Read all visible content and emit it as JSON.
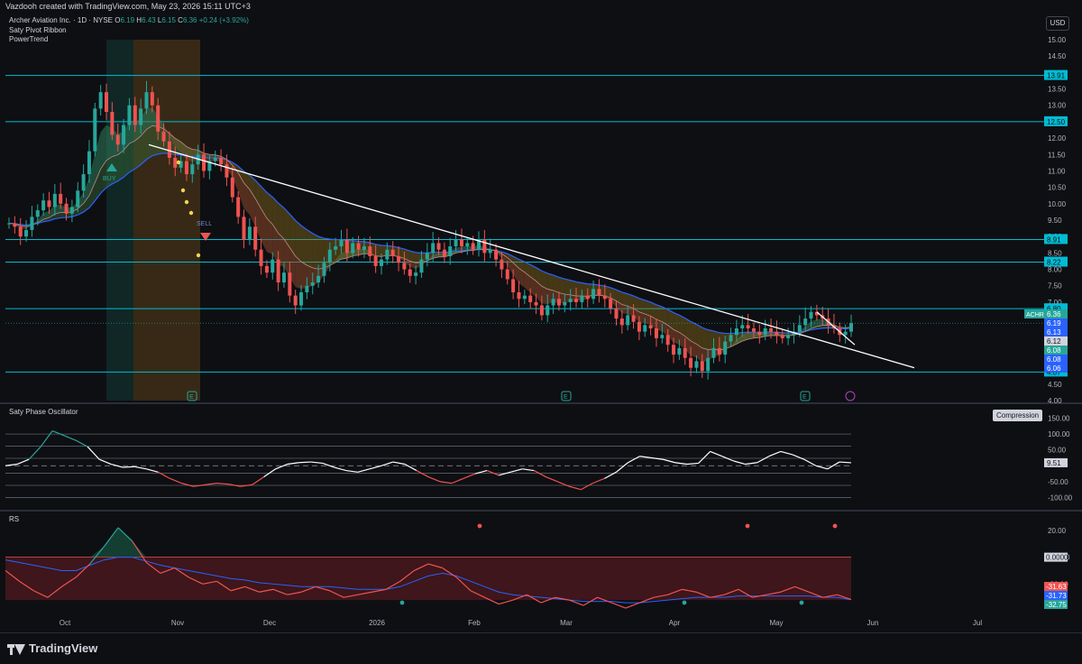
{
  "header": {
    "watermark": "Vazdooh created with TradingView.com, May 23, 2026 15:11 UTC+3"
  },
  "legend": {
    "symbol_line": "Archer Aviation Inc. · 1D · NYSE",
    "open_label": "O",
    "open": "6.19",
    "high_label": "H",
    "high": "6.43",
    "low_label": "L",
    "low": "6.15",
    "close_label": "C",
    "close": "6.36",
    "change": "+0.24 (+3.92%)",
    "indicator_1": "Saty Pivot Ribbon",
    "indicator_2": "PowerTrend"
  },
  "currency_button": "USD",
  "compression_badge": "Compression",
  "oscillator_title": "Saty Phase Oscillator",
  "rs_title": "RS",
  "footer": {
    "brand": "TradingView"
  },
  "colors": {
    "up": "#26a69a",
    "down": "#ef5350",
    "level": "#00bcd4",
    "ema_blue": "#2962ff",
    "trend": "#ffffff",
    "bg": "#0e0f13"
  },
  "chart_data": [
    {
      "type": "candlestick",
      "symbol": "ACHR",
      "ylim": [
        4.0,
        15.0
      ],
      "y_ticks": [
        "15.00",
        "14.50",
        "14.00",
        "13.50",
        "13.00",
        "12.50",
        "12.00",
        "11.50",
        "11.00",
        "10.50",
        "10.00",
        "9.50",
        "9.00",
        "8.50",
        "8.00",
        "7.50",
        "7.00",
        "6.50",
        "6.00",
        "5.50",
        "5.00",
        "4.50",
        "4.00"
      ],
      "x_labels": [
        "Oct",
        "Nov",
        "Dec",
        "2026",
        "Feb",
        "Mar",
        "Apr",
        "May",
        "Jun",
        "Jul"
      ],
      "horizontal_levels": [
        {
          "value": 13.91,
          "label": "13.91"
        },
        {
          "value": 12.5,
          "label": "12.50"
        },
        {
          "value": 8.91,
          "label": "8.91"
        },
        {
          "value": 8.22,
          "label": "8.22"
        },
        {
          "value": 6.8,
          "label": "6.80"
        },
        {
          "value": 4.87,
          "label": "4.87"
        }
      ],
      "price_labels": [
        {
          "value": 6.36,
          "label": "6.36",
          "color": "#26a69a",
          "tag": "ACHR"
        },
        {
          "value": 6.19,
          "label": "6.19",
          "color": "#2962ff"
        },
        {
          "value": 6.13,
          "label": "6.13",
          "color": "#2962ff"
        },
        {
          "value": 6.12,
          "label": "6.12",
          "color": "#d1d4dc"
        },
        {
          "value": 6.08,
          "label": "6.08",
          "color": "#26a69a"
        },
        {
          "value": 6.08,
          "label": "6.08",
          "color": "#2962ff"
        },
        {
          "value": 6.06,
          "label": "6.06",
          "color": "#2962ff"
        }
      ],
      "annotations": [
        "BUY",
        "SELL"
      ],
      "event_markers": [
        "E",
        "E",
        "E"
      ],
      "closes": [
        9.4,
        9.3,
        9.0,
        9.2,
        9.6,
        9.8,
        10.1,
        9.9,
        10.3,
        10.0,
        9.7,
        9.9,
        10.4,
        10.9,
        11.6,
        12.9,
        13.4,
        12.8,
        12.1,
        11.8,
        12.4,
        13.0,
        12.4,
        12.9,
        13.4,
        13.0,
        12.2,
        11.9,
        11.4,
        11.1,
        11.3,
        10.9,
        11.2,
        11.5,
        11.0,
        11.3,
        11.4,
        11.2,
        10.8,
        10.2,
        9.6,
        8.9,
        9.3,
        8.6,
        8.1,
        7.9,
        8.3,
        7.6,
        7.9,
        7.2,
        6.9,
        7.3,
        7.5,
        7.6,
        7.8,
        8.2,
        8.6,
        8.7,
        8.9,
        8.5,
        8.8,
        8.6,
        8.7,
        8.4,
        8.1,
        8.3,
        8.6,
        8.4,
        8.2,
        8.0,
        7.8,
        7.9,
        8.3,
        8.5,
        8.8,
        8.6,
        8.4,
        8.7,
        8.9,
        8.7,
        8.8,
        8.6,
        8.9,
        8.5,
        8.6,
        8.3,
        8.0,
        7.7,
        7.3,
        7.1,
        7.2,
        7.0,
        6.9,
        6.6,
        6.9,
        7.1,
        6.9,
        7.0,
        7.1,
        7.0,
        7.2,
        7.1,
        7.4,
        7.2,
        7.1,
        6.8,
        6.5,
        6.3,
        6.6,
        6.4,
        6.1,
        6.3,
        6.2,
        5.9,
        6.0,
        5.7,
        5.4,
        5.6,
        5.3,
        5.0,
        5.2,
        4.9,
        5.3,
        5.6,
        5.4,
        5.8,
        6.0,
        6.2,
        6.3,
        6.2,
        6.1,
        6.0,
        6.2,
        6.1,
        6.0,
        5.9,
        6.0,
        6.1,
        6.3,
        6.5,
        6.7,
        6.6,
        6.5,
        6.3,
        6.2,
        6.0,
        6.1,
        6.36
      ]
    },
    {
      "type": "line",
      "name": "Saty Phase Oscillator",
      "ylim": [
        -130,
        160
      ],
      "y_ticks": [
        "150.00",
        "100.00",
        "50.00",
        "-50.00",
        "-100.00"
      ],
      "value_label": "9.51",
      "levels": [
        100,
        61.8,
        23.6,
        0,
        -23.6,
        -61.8,
        -100
      ],
      "values": [
        0,
        5,
        20,
        60,
        110,
        95,
        80,
        60,
        20,
        5,
        -5,
        -3,
        -10,
        -20,
        -40,
        -55,
        -65,
        -60,
        -55,
        -58,
        -65,
        -60,
        -35,
        -10,
        5,
        10,
        12,
        8,
        -5,
        -15,
        -20,
        -10,
        0,
        12,
        5,
        -15,
        -35,
        -50,
        -55,
        -40,
        -25,
        -15,
        -30,
        -20,
        -10,
        -15,
        -35,
        -50,
        -65,
        -75,
        -55,
        -40,
        -20,
        10,
        30,
        25,
        20,
        10,
        5,
        8,
        45,
        30,
        15,
        5,
        10,
        30,
        45,
        35,
        20,
        0,
        -10,
        12,
        9.51
      ]
    },
    {
      "type": "line",
      "name": "RS",
      "ylim": [
        -42,
        28
      ],
      "y_ticks": [
        "20.00",
        "0.0000",
        "-20.00"
      ],
      "value_labels": [
        {
          "label": "-31.63",
          "color": "#ef5350"
        },
        {
          "label": "-31.73",
          "color": "#2962ff"
        },
        {
          "label": "-32.75",
          "color": "#26a69a"
        }
      ],
      "values": [
        -10,
        -18,
        -25,
        -30,
        -22,
        -15,
        -5,
        8,
        22,
        12,
        -4,
        -12,
        -8,
        -15,
        -20,
        -18,
        -25,
        -22,
        -26,
        -24,
        -28,
        -26,
        -22,
        -25,
        -30,
        -28,
        -26,
        -24,
        -18,
        -10,
        -5,
        -8,
        -15,
        -25,
        -30,
        -35,
        -32,
        -28,
        -34,
        -30,
        -32,
        -36,
        -30,
        -34,
        -38,
        -34,
        -30,
        -28,
        -24,
        -26,
        -30,
        -28,
        -24,
        -30,
        -28,
        -26,
        -22,
        -26,
        -30,
        -28,
        -31.63
      ],
      "signal_values": [
        -2,
        -4,
        -6,
        -8,
        -10,
        -10,
        -6,
        -2,
        0,
        0,
        -3,
        -6,
        -8,
        -10,
        -12,
        -14,
        -16,
        -17,
        -19,
        -20,
        -21,
        -22,
        -22,
        -22,
        -23,
        -24,
        -24,
        -24,
        -22,
        -18,
        -14,
        -12,
        -14,
        -18,
        -22,
        -26,
        -28,
        -29,
        -30,
        -31,
        -32,
        -33,
        -33,
        -33,
        -34,
        -34,
        -33,
        -32,
        -31,
        -30,
        -30,
        -30,
        -29,
        -29,
        -29,
        -29,
        -29,
        -29,
        -30,
        -30,
        -31.73
      ]
    }
  ]
}
